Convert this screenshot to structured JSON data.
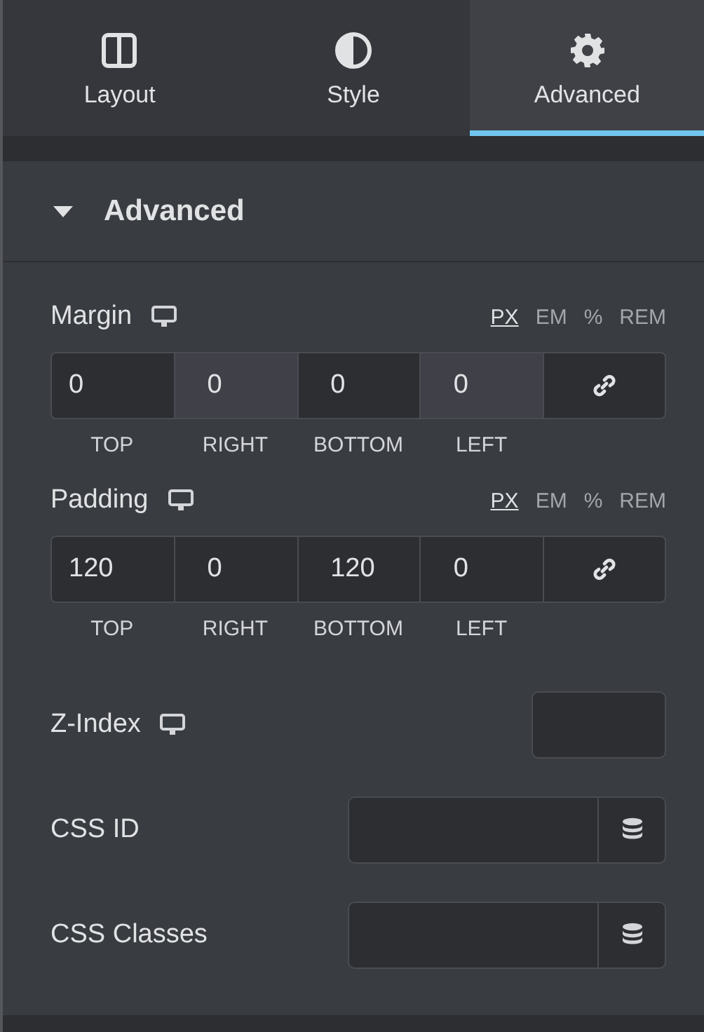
{
  "tabs": [
    {
      "label": "Layout",
      "kind": "columns",
      "selected": false
    },
    {
      "label": "Style",
      "kind": "contrast",
      "selected": false
    },
    {
      "label": "Advanced",
      "kind": "gear",
      "selected": true
    }
  ],
  "section": {
    "title": "Advanced",
    "expanded": true
  },
  "spacing": [
    {
      "label": "Margin",
      "units": [
        {
          "label": "PX",
          "selected": true
        },
        {
          "label": "EM",
          "selected": false
        },
        {
          "label": "%",
          "selected": false
        },
        {
          "label": "REM",
          "selected": false
        }
      ],
      "fields": [
        {
          "value": "0",
          "caption": "TOP",
          "highlighted": false
        },
        {
          "value": "0",
          "caption": "RIGHT",
          "highlighted": true
        },
        {
          "value": "0",
          "caption": "BOTTOM",
          "highlighted": false
        },
        {
          "value": "0",
          "caption": "LEFT",
          "highlighted": true
        }
      ]
    },
    {
      "label": "Padding",
      "units": [
        {
          "label": "PX",
          "selected": true
        },
        {
          "label": "EM",
          "selected": false
        },
        {
          "label": "%",
          "selected": false
        },
        {
          "label": "REM",
          "selected": false
        }
      ],
      "fields": [
        {
          "value": "120",
          "caption": "TOP",
          "highlighted": false
        },
        {
          "value": "0",
          "caption": "RIGHT",
          "highlighted": false
        },
        {
          "value": "120",
          "caption": "BOTTOM",
          "highlighted": false
        },
        {
          "value": "0",
          "caption": "LEFT",
          "highlighted": false
        }
      ]
    }
  ],
  "z_index": {
    "label": "Z-Index"
  },
  "text_fields": [
    {
      "label": "CSS ID"
    },
    {
      "label": "CSS Classes"
    }
  ]
}
